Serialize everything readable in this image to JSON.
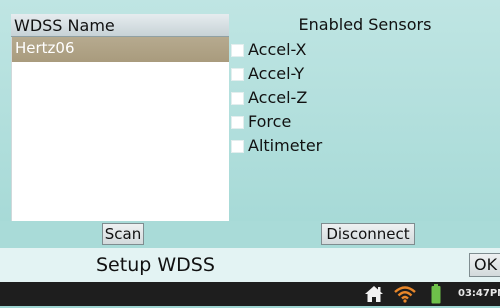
{
  "wdss_list": {
    "header": "WDSS Name",
    "items": [
      "Hertz06"
    ]
  },
  "sensors": {
    "header": "Enabled Sensors",
    "items": [
      {
        "label": "Accel-X",
        "checked": false
      },
      {
        "label": "Accel-Y",
        "checked": false
      },
      {
        "label": "Accel-Z",
        "checked": false
      },
      {
        "label": "Force",
        "checked": false
      },
      {
        "label": "Altimeter",
        "checked": false
      }
    ]
  },
  "buttons": {
    "scan": "Scan",
    "disconnect": "Disconnect",
    "ok": "OK"
  },
  "title": "Setup WDSS",
  "status_bar": {
    "time": "03:47PM",
    "icons": [
      "home-icon",
      "wifi-icon",
      "battery-icon"
    ],
    "colors": {
      "wifi": "#e8872a",
      "battery": "#6ec04a",
      "home": "#f2f2f2"
    }
  }
}
